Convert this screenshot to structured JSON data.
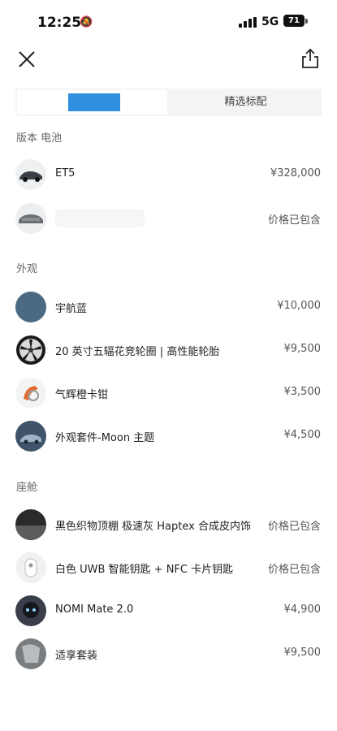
{
  "status_bar": {
    "time": "12:25",
    "network": "5G",
    "battery": "71"
  },
  "tabs": [
    {
      "label": "",
      "active": true
    },
    {
      "label": "精选标配",
      "active": false
    }
  ],
  "sections": [
    {
      "title": "版本 电池",
      "items": [
        {
          "name": "ET5",
          "price": "¥328,000",
          "icon": "car-side-icon"
        },
        {
          "name": "",
          "price": "价格已包含",
          "icon": "battery-pack-icon"
        }
      ]
    },
    {
      "title": "外观",
      "items": [
        {
          "name": "宇航蓝",
          "price": "¥10,000",
          "icon": "color-swatch-icon",
          "color": "#4b6a82"
        },
        {
          "name": "20 英寸五辐花竞轮圈 | 高性能轮胎",
          "price": "¥9,500",
          "icon": "wheel-icon"
        },
        {
          "name": "气辉橙卡钳",
          "price": "¥3,500",
          "icon": "caliper-icon",
          "color": "#e46a2b"
        },
        {
          "name": "外观套件-Moon 主题",
          "price": "¥4,500",
          "icon": "exterior-kit-icon"
        }
      ]
    },
    {
      "title": "座舱",
      "items": [
        {
          "name": "黑色织物顶棚 极速灰 Haptex 合成皮内饰",
          "price": "价格已包含",
          "icon": "interior-icon"
        },
        {
          "name": "白色 UWB 智能钥匙 + NFC 卡片钥匙",
          "price": "价格已包含",
          "icon": "key-fob-icon"
        },
        {
          "name": "NOMI Mate 2.0",
          "price": "¥4,900",
          "icon": "nomi-icon"
        },
        {
          "name": "适享套装",
          "price": "¥9,500",
          "icon": "seat-icon"
        }
      ]
    }
  ]
}
